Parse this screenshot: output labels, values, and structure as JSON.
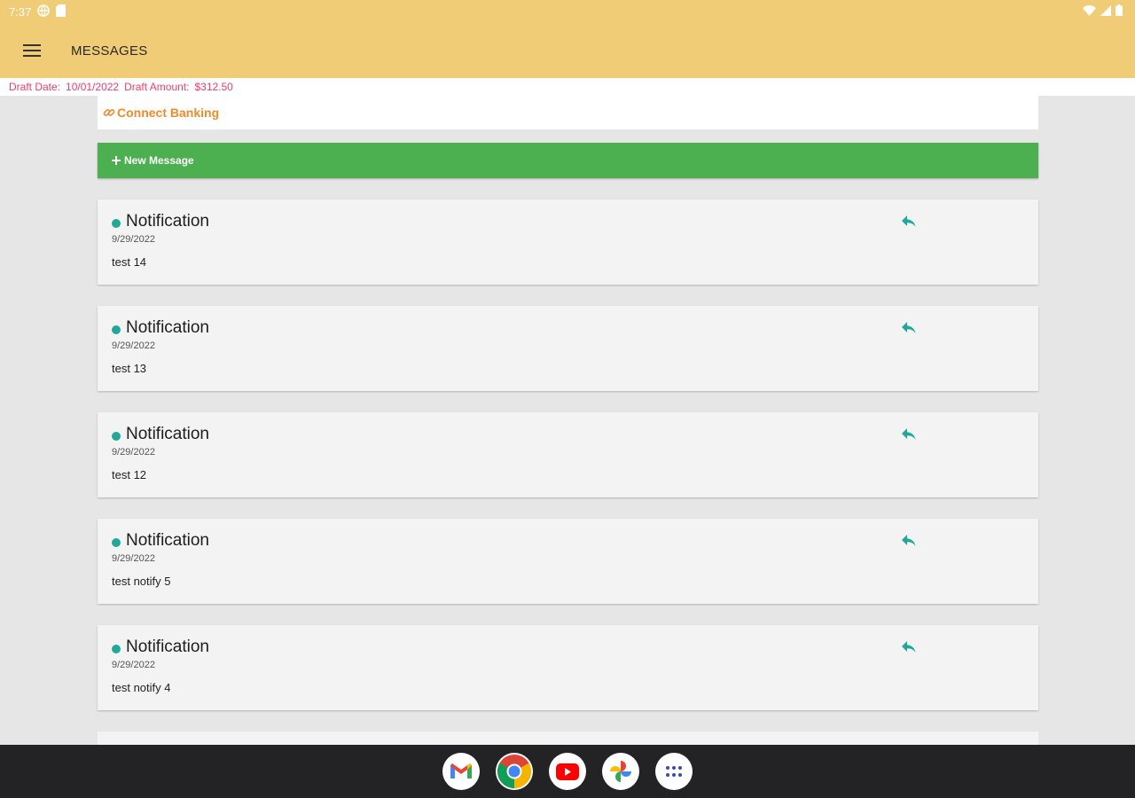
{
  "status_bar": {
    "time": "7:37"
  },
  "app_bar": {
    "title": "MESSAGES"
  },
  "draft": {
    "date_label": "Draft Date:",
    "date_value": "10/01/2022",
    "amount_label": "Draft Amount:",
    "amount_value": "$312.50"
  },
  "connect_banking": {
    "label": "Connect Banking"
  },
  "new_message": {
    "label": "New Message"
  },
  "messages": [
    {
      "title": "Notification",
      "date": "9/29/2022",
      "body": "test 14"
    },
    {
      "title": "Notification",
      "date": "9/29/2022",
      "body": "test 13"
    },
    {
      "title": "Notification",
      "date": "9/29/2022",
      "body": "test 12"
    },
    {
      "title": "Notification",
      "date": "9/29/2022",
      "body": "test notify 5"
    },
    {
      "title": "Notification",
      "date": "9/29/2022",
      "body": "test notify 4"
    }
  ],
  "dock": [
    "gmail-icon",
    "chrome-icon",
    "youtube-icon",
    "photos-icon",
    "apps-icon"
  ],
  "colors": {
    "app_bar": "#efcc75",
    "new_message": "#4caf50",
    "accent_teal": "#22a89a",
    "draft_text": "#ef3d6a",
    "connect_text": "#f08a2a"
  }
}
